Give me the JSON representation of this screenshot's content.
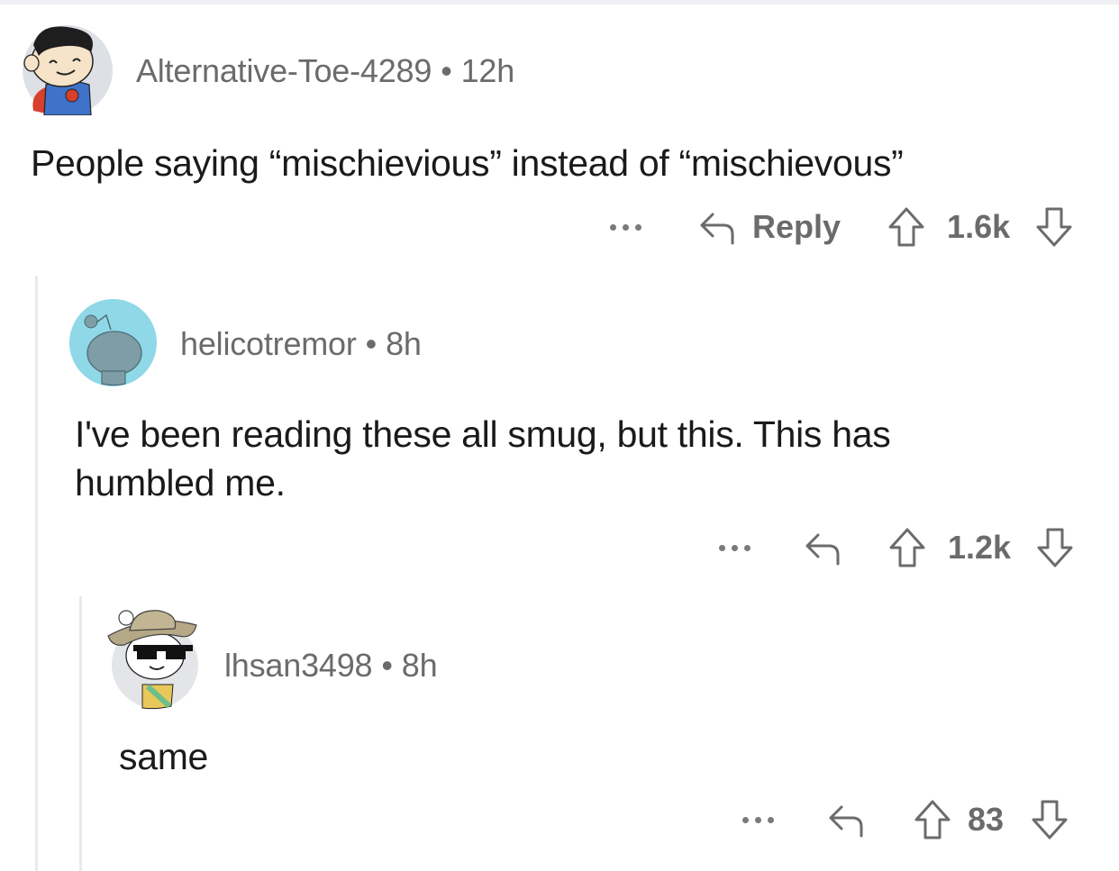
{
  "comments": [
    {
      "username": "Alternative-Toe-4289",
      "separator": "•",
      "age": "12h",
      "body": "People saying “mischievious” instead of “mischievous”",
      "actions": {
        "more_icon": "ellipsis-icon",
        "reply_icon": "reply-arrow-icon",
        "reply_label": "Reply",
        "upvote_icon": "upvote-arrow-icon",
        "score": "1.6k",
        "downvote_icon": "downvote-arrow-icon"
      },
      "avatar": {
        "description": "superman-style snoo",
        "bg": "#dde1e6"
      }
    },
    {
      "username": "helicotremor",
      "separator": "•",
      "age": "8h",
      "body_lines": [
        "I've been reading these all smug, but this. This has",
        "humbled me."
      ],
      "actions": {
        "more_icon": "ellipsis-icon",
        "reply_icon": "reply-arrow-icon",
        "upvote_icon": "upvote-arrow-icon",
        "score": "1.2k",
        "downvote_icon": "downvote-arrow-icon"
      },
      "avatar": {
        "description": "default snoo silhouette",
        "bg": "#8fd8e8"
      }
    },
    {
      "username": "lhsan3498",
      "separator": "•",
      "age": "8h",
      "body": "same",
      "actions": {
        "more_icon": "ellipsis-icon",
        "reply_icon": "reply-arrow-icon",
        "upvote_icon": "upvote-arrow-icon",
        "score": "83",
        "downvote_icon": "downvote-arrow-icon"
      },
      "avatar": {
        "description": "snoo with hat and pixel sunglasses",
        "bg": "#e3e5e8"
      }
    }
  ],
  "colors": {
    "meta_text": "#6b6b6b",
    "body_text": "#1a1a1b",
    "thread_line": "#eaeaea"
  }
}
